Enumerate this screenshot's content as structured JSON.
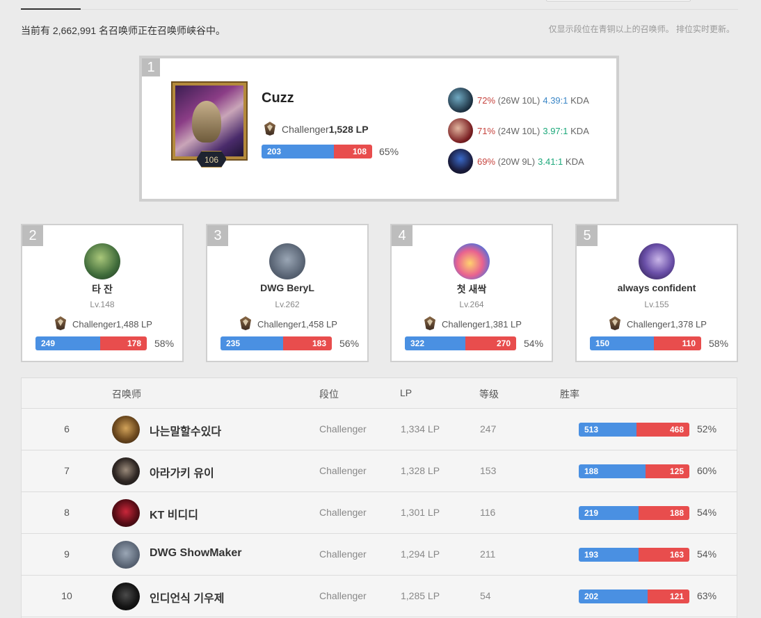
{
  "header": {
    "summary": "当前有 2,662,991 名召唤师正在召唤师峡谷中。",
    "notice": "仅显示段位在青铜以上的召唤师。 排位实时更新。"
  },
  "top1": {
    "rank": "1",
    "name": "Cuzz",
    "level": "106",
    "tier": "Challenger",
    "lp": "1,528 LP",
    "wins": 203,
    "losses": 108,
    "wins_label": "203",
    "losses_label": "108",
    "winrate": "65%",
    "champions": [
      {
        "pct": "72%",
        "record": "(26W 10L)",
        "kda": "4.39:1",
        "kda_suffix": "KDA",
        "kda_color": "blue"
      },
      {
        "pct": "71%",
        "record": "(24W 10L)",
        "kda": "3.97:1",
        "kda_suffix": "KDA",
        "kda_color": "green"
      },
      {
        "pct": "69%",
        "record": "(20W 9L)",
        "kda": "3.41:1",
        "kda_suffix": "KDA",
        "kda_color": "green"
      }
    ]
  },
  "top_cards": [
    {
      "rank": "2",
      "name": "타 잔",
      "level": "Lv.148",
      "tier": "Challenger",
      "lp": "1,488 LP",
      "wins": 249,
      "losses": 178,
      "wins_label": "249",
      "losses_label": "178",
      "winrate": "58%"
    },
    {
      "rank": "3",
      "name": "DWG BeryL",
      "level": "Lv.262",
      "tier": "Challenger",
      "lp": "1,458 LP",
      "wins": 235,
      "losses": 183,
      "wins_label": "235",
      "losses_label": "183",
      "winrate": "56%"
    },
    {
      "rank": "4",
      "name": "첫 새싹",
      "level": "Lv.264",
      "tier": "Challenger",
      "lp": "1,381 LP",
      "wins": 322,
      "losses": 270,
      "wins_label": "322",
      "losses_label": "270",
      "winrate": "54%"
    },
    {
      "rank": "5",
      "name": "always confident",
      "level": "Lv.155",
      "tier": "Challenger",
      "lp": "1,378 LP",
      "wins": 150,
      "losses": 110,
      "wins_label": "150",
      "losses_label": "110",
      "winrate": "58%"
    }
  ],
  "table": {
    "headers": {
      "summoner": "召唤师",
      "tier": "段位",
      "lp": "LP",
      "level": "等级",
      "winrate": "胜率"
    },
    "rows": [
      {
        "rank": "6",
        "name": "나는말할수있다",
        "tier": "Challenger",
        "lp": "1,334 LP",
        "level": "247",
        "wins": 513,
        "losses": 468,
        "wins_label": "513",
        "losses_label": "468",
        "winrate": "52%"
      },
      {
        "rank": "7",
        "name": "아라가키 유이",
        "tier": "Challenger",
        "lp": "1,328 LP",
        "level": "153",
        "wins": 188,
        "losses": 125,
        "wins_label": "188",
        "losses_label": "125",
        "winrate": "60%"
      },
      {
        "rank": "8",
        "name": "KT 비디디",
        "tier": "Challenger",
        "lp": "1,301 LP",
        "level": "116",
        "wins": 219,
        "losses": 188,
        "wins_label": "219",
        "losses_label": "188",
        "winrate": "54%"
      },
      {
        "rank": "9",
        "name": "DWG ShowMaker",
        "tier": "Challenger",
        "lp": "1,294 LP",
        "level": "211",
        "wins": 193,
        "losses": 163,
        "wins_label": "193",
        "losses_label": "163",
        "winrate": "54%"
      },
      {
        "rank": "10",
        "name": "인디언식 기우제",
        "tier": "Challenger",
        "lp": "1,285 LP",
        "level": "54",
        "wins": 202,
        "losses": 121,
        "wins_label": "202",
        "losses_label": "121",
        "winrate": "63%"
      }
    ]
  },
  "colors": {
    "win": "#4a90e2",
    "loss": "#e84d4d",
    "kda_blue": "#3a86c6",
    "kda_green": "#1ba87a",
    "pct_red": "#c6443e"
  },
  "icons": {
    "tier_emblem": "challenger-emblem-icon",
    "rank_badge": "rank-number-badge"
  }
}
